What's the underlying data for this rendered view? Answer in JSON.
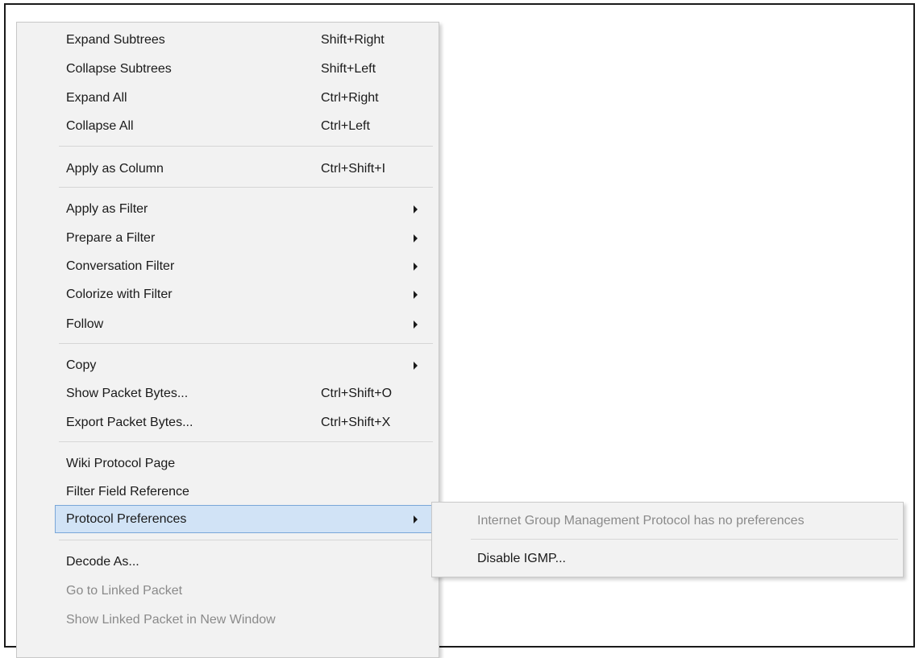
{
  "context_menu": {
    "groups": [
      [
        {
          "label": "Expand Subtrees",
          "shortcut": "Shift+Right"
        },
        {
          "label": "Collapse Subtrees",
          "shortcut": "Shift+Left"
        },
        {
          "label": "Expand All",
          "shortcut": "Ctrl+Right"
        },
        {
          "label": "Collapse All",
          "shortcut": "Ctrl+Left"
        }
      ],
      [
        {
          "label": "Apply as Column",
          "shortcut": "Ctrl+Shift+I"
        }
      ],
      [
        {
          "label": "Apply as Filter",
          "submenu_arrow": true
        },
        {
          "label": "Prepare a Filter",
          "submenu_arrow": true
        },
        {
          "label": "Conversation Filter",
          "submenu_arrow": true
        },
        {
          "label": "Colorize with Filter",
          "submenu_arrow": true
        },
        {
          "label": "Follow",
          "submenu_arrow": true
        }
      ],
      [
        {
          "label": "Copy",
          "submenu_arrow": true
        },
        {
          "label": "Show Packet Bytes...",
          "shortcut": "Ctrl+Shift+O"
        },
        {
          "label": "Export Packet Bytes...",
          "shortcut": "Ctrl+Shift+X"
        }
      ],
      [
        {
          "label": "Wiki Protocol Page"
        },
        {
          "label": "Filter Field Reference"
        },
        {
          "label": "Protocol Preferences",
          "submenu_arrow": true,
          "highlighted": true
        }
      ],
      [
        {
          "label": "Decode As..."
        },
        {
          "label": "Go to Linked Packet",
          "disabled": true
        },
        {
          "label": "Show Linked Packet in New Window",
          "disabled": true
        }
      ]
    ]
  },
  "submenu": {
    "info_text": "Internet Group Management Protocol has no preferences",
    "action_label": "Disable IGMP..."
  },
  "colors": {
    "menu_background": "#f2f2f2",
    "highlight_background": "#d1e3f6",
    "highlight_border": "#7aa7d8",
    "disabled_text": "#8a8a8a"
  }
}
